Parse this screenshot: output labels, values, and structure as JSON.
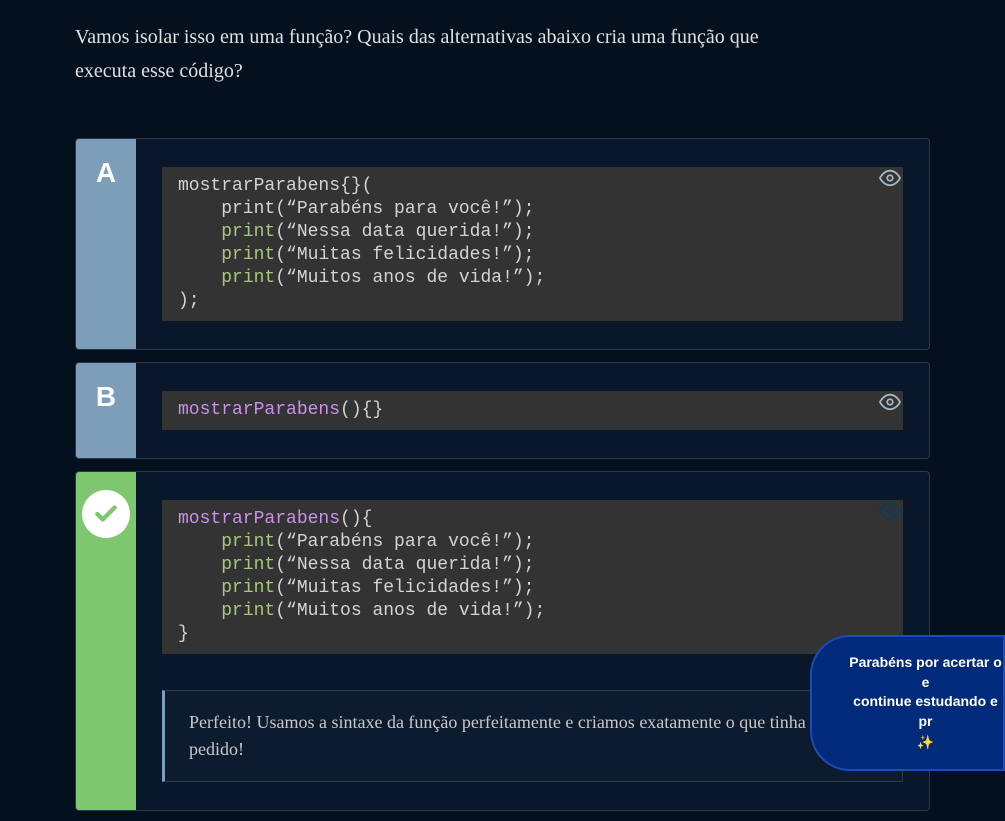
{
  "question": "Vamos isolar isso em uma função? Quais das alternativas abaixo cria uma função que executa esse código?",
  "options": {
    "A": {
      "letter": "A",
      "code": {
        "l1a": "mostrarParabens{}(",
        "l2a": "    print(“Parabéns para você!”);",
        "l3b": "(“Nessa data querida!”);",
        "l4b": "(“Muitas felicidades!”);",
        "l5b": "(“Muitos anos de vida!”);",
        "l6a": ");",
        "print": "print"
      }
    },
    "B": {
      "letter": "B",
      "code": {
        "fn": "mostrarParabens",
        "rest": "(){}"
      }
    },
    "C": {
      "code": {
        "fn": "mostrarParabens",
        "l1b": "(){",
        "l2b": "(“Parabéns para você!”);",
        "l3b": "(“Nessa data querida!”);",
        "l4b": "(“Muitas felicidades!”);",
        "l5b": "(“Muitos anos de vida!”);",
        "l6a": "}",
        "print": "print"
      },
      "feedback": "Perfeito! Usamos a sintaxe da função perfeitamente e criamos exatamente o que tinha sido pedido!"
    }
  },
  "toast": {
    "line1": "Parabéns por acertar o e",
    "line2": "continue estudando e pr",
    "sparkle": "✨"
  },
  "indent": "    ",
  "colors": {
    "badge": "#7d9eb8",
    "correct": "#7ec76e",
    "code_bg": "#333333",
    "keyword": "#a7c77d",
    "fn": "#c792ea"
  }
}
